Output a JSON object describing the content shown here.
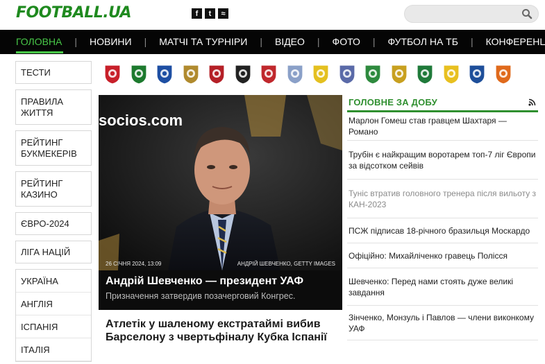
{
  "header": {
    "logo": "FOOTBALL.UA",
    "social": [
      {
        "name": "facebook-icon",
        "glyph": "f"
      },
      {
        "name": "twitter-icon",
        "glyph": "t"
      },
      {
        "name": "rss-icon",
        "glyph": "≈"
      }
    ],
    "search_placeholder": ""
  },
  "nav": {
    "items": [
      "ГОЛОВНА",
      "НОВИНИ",
      "МАТЧІ ТА ТУРНІРИ",
      "ВІДЕО",
      "ФОТО",
      "ФУТБОЛ НА ТБ",
      "КОНФЕРЕНЦ"
    ],
    "active_index": 0,
    "active_color": "#48c848"
  },
  "sidebar": {
    "items": [
      "ТЕСТИ",
      "ПРАВИЛА ЖИТТЯ",
      "РЕЙТИНГ БУКМЕКЕРІВ",
      "РЕЙТИНГ КАЗИНО",
      "ЄВРО-2024",
      "ЛІГА НАЦІЙ"
    ],
    "countries": [
      "УКРАЇНА",
      "АНГЛІЯ",
      "ІСПАНІЯ",
      "ІТАЛІЯ"
    ]
  },
  "clubs": [
    {
      "icon": "veres-logo",
      "color": "#c8202a"
    },
    {
      "icon": "vorskla-logo",
      "color": "#1d7a2e"
    },
    {
      "icon": "dynamo-logo",
      "color": "#1e4fa3"
    },
    {
      "icon": "trophy-logo",
      "color": "#b08a2e"
    },
    {
      "icon": "zorya-logo",
      "color": "#b52027"
    },
    {
      "icon": "kolos-logo",
      "color": "#222222"
    },
    {
      "icon": "kryvbas-logo",
      "color": "#c0282d"
    },
    {
      "icon": "lnz-logo",
      "color": "#8aa0c8"
    },
    {
      "icon": "metalist-logo",
      "color": "#e4c020"
    },
    {
      "icon": "minaj-logo",
      "color": "#5a6aa8"
    },
    {
      "icon": "obolon-logo",
      "color": "#2e8a3e"
    },
    {
      "icon": "oleksandriya-logo",
      "color": "#c8a020"
    },
    {
      "icon": "polissya-logo",
      "color": "#1f7a3a"
    },
    {
      "icon": "rukh-logo",
      "color": "#e8c020"
    },
    {
      "icon": "chornomorets-logo",
      "color": "#1e4f9a"
    },
    {
      "icon": "shakhtar-logo",
      "color": "#e06a1c"
    }
  ],
  "hero": {
    "date": "26 СІЧНЯ 2024, 13:09",
    "credit": "АНДРІЙ ШЕВЧЕНКО, GETTY IMAGES",
    "title": "Андрій Шевченко — президент УАФ",
    "subtitle": "Призначення затвердив позачерговий Конгрес.",
    "backdrop_text": "socios.com"
  },
  "headline2": "Атлетік у шаленому екстратаймі вибив Барселону з чвертьфіналу Кубка Іспанії",
  "day": {
    "title": "ГОЛОВНЕ ЗА ДОБУ",
    "news": [
      {
        "text": "Марлон Гомеш став гравцем Шахтаря — Романо",
        "grey": false
      },
      {
        "text": "Трубін є найкращим воротарем топ-7 ліг Європи за відсотком сейвів",
        "grey": false
      },
      {
        "text": "Туніс втратив головного тренера після вильоту з КАН-2023",
        "grey": true
      },
      {
        "text": "ПСЖ підписав 18-річного бразильця Москардо",
        "grey": false
      },
      {
        "text": "Офіційно: Михайліченко гравець Полісся",
        "grey": false
      },
      {
        "text": "Шевченко: Перед нами стоять дуже великі завдання",
        "grey": false
      },
      {
        "text": "Зінченко, Монзуль і Павлов — члени виконкому УАФ",
        "grey": false
      }
    ]
  }
}
